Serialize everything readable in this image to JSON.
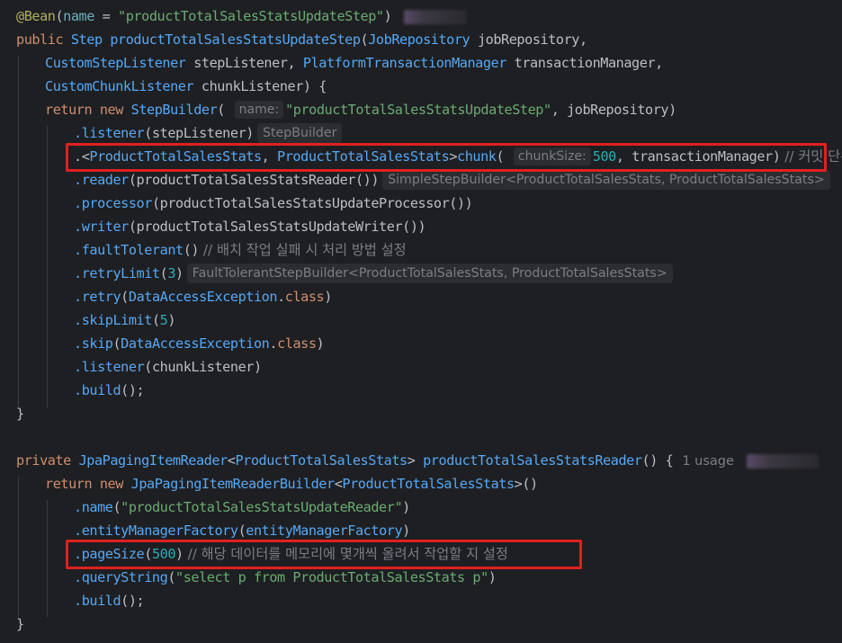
{
  "code": {
    "l1_annotation": "@Bean",
    "l1_open": "(",
    "l1_attr": "name",
    "l1_eq": " = ",
    "l1_str": "\"productTotalSalesStatsUpdateStep\"",
    "l1_close": ")",
    "l2_kw": "public ",
    "l2_type": "Step ",
    "l2_name": "productTotalSalesStatsUpdateStep",
    "l2_rest_type": "JobRepository",
    "l2_rest_param": " jobRepository,",
    "l2_open": "(",
    "l3_type1": "CustomStepListener",
    "l3_p1": " stepListener, ",
    "l3_type2": "PlatformTransactionManager",
    "l3_p2": " transactionManager,",
    "l4_type": "CustomChunkListener",
    "l4_p": " chunkListener) {",
    "l5_kw": "return new ",
    "l5_type": "StepBuilder",
    "l5_open": "( ",
    "l5_hint": "name:",
    "l5_str": "\"productTotalSalesStatsUpdateStep\"",
    "l5_rest": ", jobRepository)",
    "l6_method": ".listener",
    "l6_arg": "(stepListener)",
    "l6_hint": "StepBuilder",
    "l7_pre": ".<",
    "l7_t1": "ProductTotalSalesStats",
    "l7_comma": ", ",
    "l7_t2": "ProductTotalSalesStats",
    "l7_gt": ">",
    "l7_method": "chunk",
    "l7_open": "( ",
    "l7_hint": "chunkSize:",
    "l7_num": "500",
    "l7_rest": ", transactionManager)",
    "l7_comment": " // 커밋 단위",
    "l8_method": ".reader",
    "l8_arg": "(productTotalSalesStatsReader())",
    "l8_hint": "SimpleStepBuilder<ProductTotalSalesStats, ProductTotalSalesStats>",
    "l9_method": ".processor",
    "l9_arg": "(productTotalSalesStatsUpdateProcessor())",
    "l10_method": ".writer",
    "l10_arg": "(productTotalSalesStatsUpdateWriter())",
    "l11_method": ".faultTolerant",
    "l11_arg": "()",
    "l11_comment": " // 배치 작업 실패 시 처리 방법 설정",
    "l12_method": ".retryLimit",
    "l12_open": "(",
    "l12_num": "3",
    "l12_close": ")",
    "l12_hint": "FaultTolerantStepBuilder<ProductTotalSalesStats, ProductTotalSalesStats>",
    "l13_method": ".retry",
    "l13_open": "(",
    "l13_type": "DataAccessException",
    "l13_dot": ".",
    "l13_kw": "class",
    "l13_close": ")",
    "l14_method": ".skipLimit",
    "l14_open": "(",
    "l14_num": "5",
    "l14_close": ")",
    "l15_method": ".skip",
    "l15_open": "(",
    "l15_type": "DataAccessException",
    "l15_dot": ".",
    "l15_kw": "class",
    "l15_close": ")",
    "l16_method": ".listener",
    "l16_arg": "(chunkListener)",
    "l17_method": ".build",
    "l17_arg": "();",
    "l18": "}",
    "l20_kw": "private ",
    "l20_type": "JpaPagingItemReader",
    "l20_lt": "<",
    "l20_gen": "ProductTotalSalesStats",
    "l20_gt": "> ",
    "l20_name": "productTotalSalesStatsReader",
    "l20_rest": "() {",
    "l20_usage": "1 usage",
    "l21_kw": "return new ",
    "l21_type": "JpaPagingItemReaderBuilder",
    "l21_lt": "<",
    "l21_gen": "ProductTotalSalesStats",
    "l21_rest": ">()",
    "l22_method": ".name",
    "l22_open": "(",
    "l22_str": "\"productTotalSalesStatsUpdateReader\"",
    "l22_close": ")",
    "l23_method": ".entityManagerFactory",
    "l23_open": "(",
    "l23_field": "entityManagerFactory",
    "l23_close": ")",
    "l24_method": ".pageSize",
    "l24_open": "(",
    "l24_num": "500",
    "l24_close": ")",
    "l24_comment": " // 해당 데이터를 메모리에 몇개씩 올려서 작업할 지 설정",
    "l25_method": ".queryString",
    "l25_open": "(",
    "l25_str": "\"select p from ProductTotalSalesStats p\"",
    "l25_close": ")",
    "l26_method": ".build",
    "l26_arg": "();",
    "l27": "}"
  },
  "colors": {
    "background": "#1e1f22",
    "keyword": "#cf8e6d",
    "string": "#6aab73",
    "number": "#2aacb8",
    "method": "#56a8f5",
    "annotation": "#b3ae60",
    "comment": "#7a7e85",
    "highlight_box": "#e02020"
  }
}
